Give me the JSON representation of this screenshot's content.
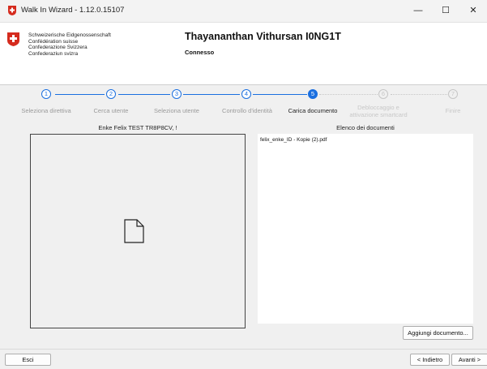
{
  "window": {
    "title": "Walk In Wizard - 1.12.0.15107",
    "minimize_glyph": "—",
    "maximize_glyph": "☐",
    "close_glyph": "✕"
  },
  "header": {
    "confed_lines": [
      "Schweizerische Eidgenossenschaft",
      "Confédération suisse",
      "Confederazione Svizzera",
      "Confederaziun svizra"
    ],
    "user_name": "Thayananthan Vithursan I0NG1T",
    "status": "Connesso"
  },
  "steps": [
    {
      "number": "1",
      "label": "Seleziona direttiva",
      "state": "done"
    },
    {
      "number": "2",
      "label": "Cerca utente",
      "state": "done"
    },
    {
      "number": "3",
      "label": "Seleziona utente",
      "state": "done"
    },
    {
      "number": "4",
      "label": "Controllo d'identità",
      "state": "done"
    },
    {
      "number": "5",
      "label": "Carica documento",
      "state": "active"
    },
    {
      "number": "6",
      "label": "Debloccaggio e attivazione smartcard",
      "state": "future"
    },
    {
      "number": "7",
      "label": "Finire",
      "state": "future"
    }
  ],
  "preview": {
    "title": "Enke Felix TEST TR8P8CV, !",
    "icon": "document-icon"
  },
  "documents": {
    "title": "Elenco dei documenti",
    "items": [
      "felix_enke_ID - Kopie (2).pdf"
    ],
    "add_button": "Aggiungi documento..."
  },
  "footer": {
    "exit_button": "Esci",
    "back_button": "< Indietro",
    "next_button": "Avanti >"
  },
  "colors": {
    "accent": "#1a6fe0",
    "swiss_red": "#d52b1e"
  }
}
